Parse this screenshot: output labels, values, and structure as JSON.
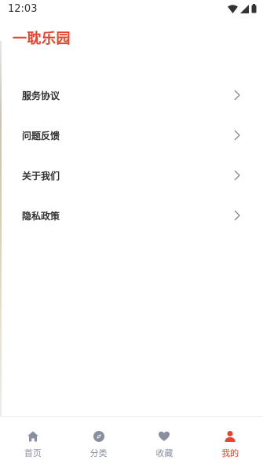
{
  "status_bar": {
    "time": "12:03",
    "icons": [
      "wifi-icon",
      "signal-icon",
      "battery-icon"
    ]
  },
  "app": {
    "title": "一耽乐园",
    "accent_color": "#e8432e"
  },
  "menu": {
    "items": [
      {
        "label": "服务协议",
        "icon": "chevron-right-icon"
      },
      {
        "label": "问题反馈",
        "icon": "chevron-right-icon"
      },
      {
        "label": "关于我们",
        "icon": "chevron-right-icon"
      },
      {
        "label": "隐私政策",
        "icon": "chevron-right-icon"
      }
    ]
  },
  "tabbar": {
    "tabs": [
      {
        "label": "首页",
        "icon": "home-icon",
        "active": false
      },
      {
        "label": "分类",
        "icon": "compass-icon",
        "active": false
      },
      {
        "label": "收藏",
        "icon": "heart-icon",
        "active": false
      },
      {
        "label": "我的",
        "icon": "user-icon",
        "active": true
      }
    ],
    "inactive_color": "#8a8fa0",
    "active_color": "#e8432e"
  }
}
